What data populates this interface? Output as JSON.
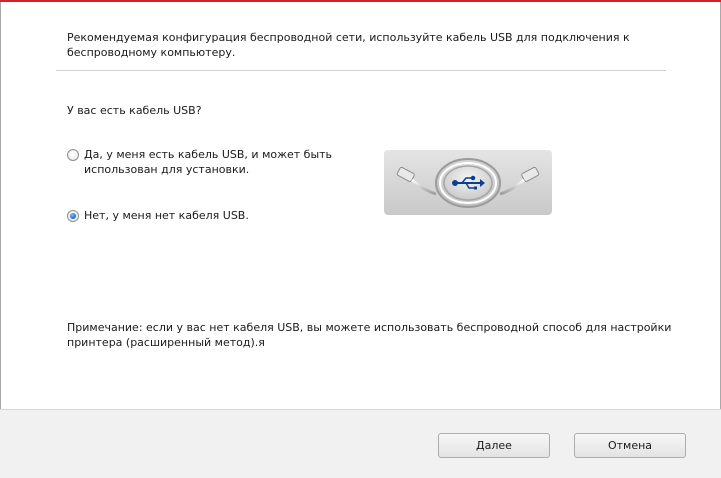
{
  "header": {
    "intro_text": "Рекомендуемая конфигурация беспроводной сети, используйте кабель USB для подключения к беспроводному компьютеру."
  },
  "question": {
    "label": "У вас есть кабель USB?"
  },
  "options": [
    {
      "label": "Да, у меня есть кабель USB, и может быть использован для установки.",
      "selected": false
    },
    {
      "label": "Нет, у меня нет кабеля USB.",
      "selected": true
    }
  ],
  "note": {
    "text": "Примечание: если у вас нет кабеля USB, вы можете использовать беспроводной способ для настройки принтера (расширенный метод).я"
  },
  "buttons": {
    "next_label": "Далее",
    "cancel_label": "Отмена"
  },
  "colors": {
    "accent": "#d4202a",
    "radio_selected": "#1c6fd1",
    "usb_symbol": "#0d3f8f"
  }
}
